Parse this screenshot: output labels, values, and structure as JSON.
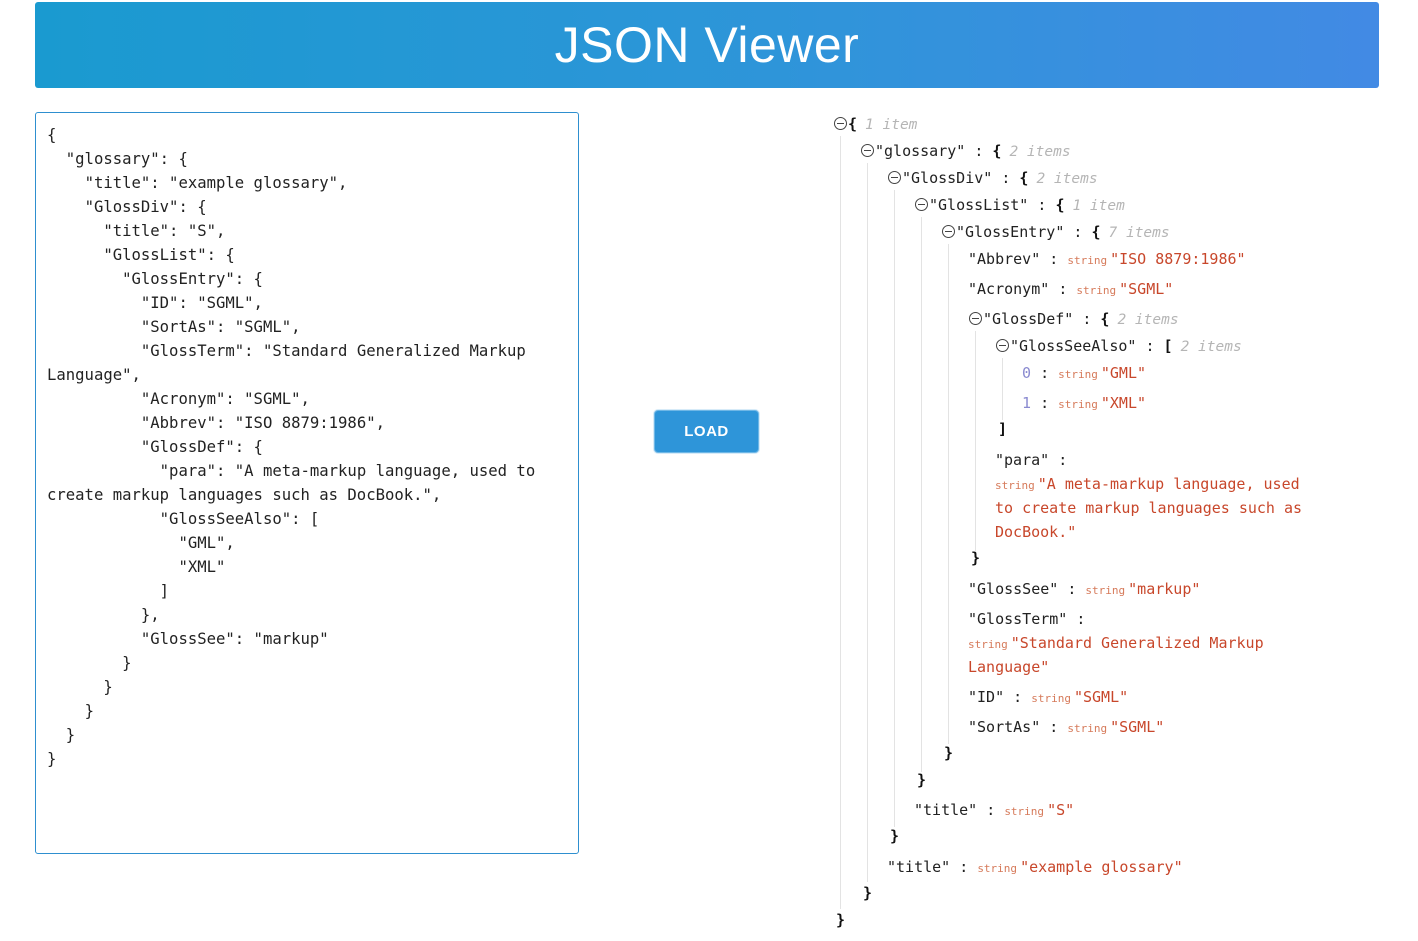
{
  "header": {
    "title": "JSON Viewer"
  },
  "editor": {
    "value": "{\n  \"glossary\": {\n    \"title\": \"example glossary\",\n    \"GlossDiv\": {\n      \"title\": \"S\",\n      \"GlossList\": {\n        \"GlossEntry\": {\n          \"ID\": \"SGML\",\n          \"SortAs\": \"SGML\",\n          \"GlossTerm\": \"Standard Generalized Markup Language\",\n          \"Acronym\": \"SGML\",\n          \"Abbrev\": \"ISO 8879:1986\",\n          \"GlossDef\": {\n            \"para\": \"A meta-markup language, used to create markup languages such as DocBook.\",\n            \"GlossSeeAlso\": [\n              \"GML\",\n              \"XML\"\n            ]\n          },\n          \"GlossSee\": \"markup\"\n        }\n      }\n    }\n  }\n}"
  },
  "load_button": {
    "label": "LOAD"
  },
  "viewer": {
    "string_type": "string",
    "root": {
      "open": "{",
      "close": "}",
      "count": "1 item"
    },
    "glossary": {
      "key": "\"glossary\"",
      "open": "{",
      "close": "}",
      "count": "2 items"
    },
    "glossdiv": {
      "key": "\"GlossDiv\"",
      "open": "{",
      "close": "}",
      "count": "2 items"
    },
    "glosslist": {
      "key": "\"GlossList\"",
      "open": "{",
      "close": "}",
      "count": "1 item"
    },
    "glossentry": {
      "key": "\"GlossEntry\"",
      "open": "{",
      "close": "}",
      "count": "7 items"
    },
    "abbrev": {
      "key": "\"Abbrev\"",
      "value": "\"ISO 8879:1986\""
    },
    "acronym": {
      "key": "\"Acronym\"",
      "value": "\"SGML\""
    },
    "glossdef": {
      "key": "\"GlossDef\"",
      "open": "{",
      "close": "}",
      "count": "2 items"
    },
    "glossseealso": {
      "key": "\"GlossSeeAlso\"",
      "open": "[",
      "close": "]",
      "count": "2 items",
      "items": [
        {
          "index": "0",
          "value": "\"GML\""
        },
        {
          "index": "1",
          "value": "\"XML\""
        }
      ]
    },
    "para": {
      "key": "\"para\"",
      "value_line1": "\"A meta-markup language, used",
      "value_line2": "to create markup languages such as",
      "value_line3": "DocBook.\""
    },
    "glosssee": {
      "key": "\"GlossSee\"",
      "value": "\"markup\""
    },
    "glossterm": {
      "key": "\"GlossTerm\"",
      "value_line1": "\"Standard Generalized Markup",
      "value_line2": "Language\""
    },
    "id": {
      "key": "\"ID\"",
      "value": "\"SGML\""
    },
    "sortas": {
      "key": "\"SortAs\"",
      "value": "\"SGML\""
    },
    "glossdiv_title": {
      "key": "\"title\"",
      "value": "\"S\""
    },
    "glossary_title": {
      "key": "\"title\"",
      "value": "\"example glossary\""
    },
    "colon": ":"
  }
}
